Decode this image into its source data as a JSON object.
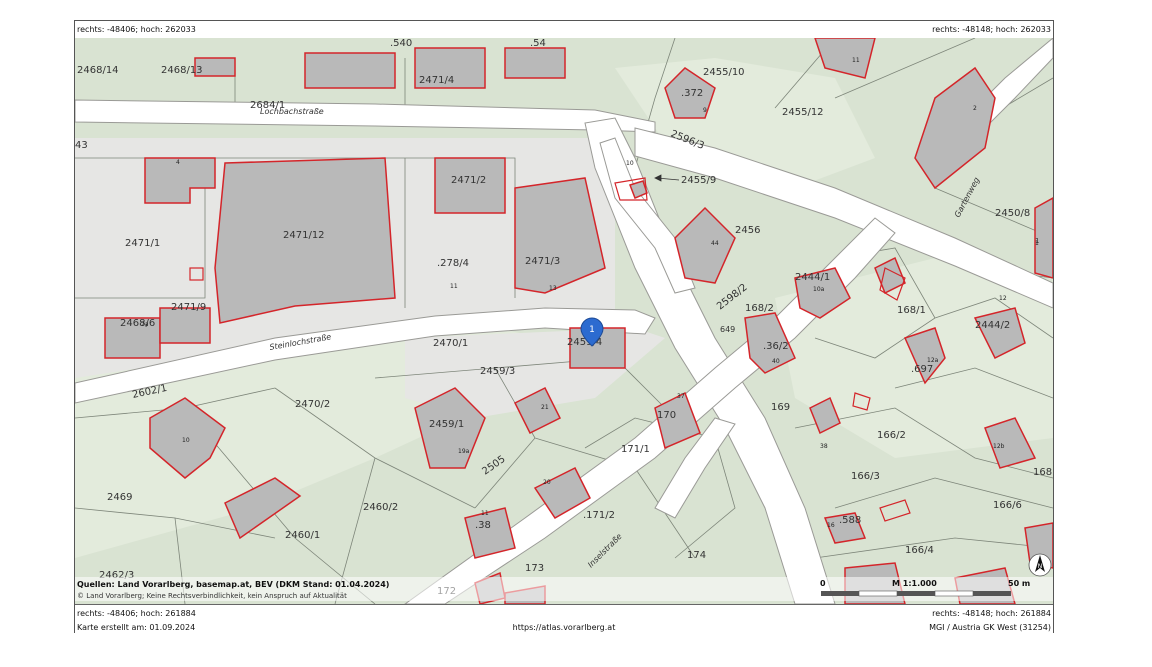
{
  "coords": {
    "top_left": "rechts: -48406; hoch: 262033",
    "top_right": "rechts: -48148; hoch: 262033",
    "bottom_left": "rechts: -48406; hoch: 261884",
    "bottom_right": "rechts: -48148; hoch: 261884"
  },
  "footer": {
    "created": "Karte erstellt am: 01.09.2024",
    "url": "https://atlas.vorarlberg.at",
    "projection": "MGI / Austria GK West (31254)"
  },
  "attribution": {
    "line1": "Quellen: Land Vorarlberg, basemap.at, BEV (DKM Stand: 01.04.2024)",
    "line2": "© Land Vorarlberg; Keine Rechtsverbindlichkeit, kein Anspruch auf Aktualität"
  },
  "scale": {
    "zero": "0",
    "ratio": "M 1:1.000",
    "distance": "50 m"
  },
  "north_arrow": {
    "letter": "N",
    "icon": "north-arrow-icon"
  },
  "marker": {
    "number": "1",
    "icon": "map-pin-icon"
  },
  "streets": {
    "lochbach": "Lochbachstraße",
    "steinloch": "Steinlochstraße",
    "garten": "Gartenweg",
    "insel": "Inselstraße"
  },
  "parcels": {
    "p2468_14": "2468/14",
    "p2468_13": "2468/13",
    "p2471_4": "2471/4",
    "p540": ".540",
    "p54": ".54",
    "p2455_10": "2455/10",
    "p372": ".372",
    "p2455_12": "2455/12",
    "p2684_1": "2684/1",
    "p43": "43",
    "p2596_3": "2596/3",
    "p2471_2": "2471/2",
    "p2455_9": "2455/9",
    "p2471_12": "2471/12",
    "p2471_1": "2471/1",
    "p278_4": ".278/4",
    "p2471_3": "2471/3",
    "p2456": "2456",
    "p2450_8": "2450/8",
    "p2444_1": "2444/1",
    "p2598_2": "2598/2",
    "p168_2": "168/2",
    "p168_1": "168/1",
    "p2444_2": "2444/2",
    "p2468_6": "2468/6",
    "p2471_9": "2471/9",
    "p2470_1": "2470/1",
    "p2459_4": "2459/4",
    "p649": "649",
    "p36_2": ".36/2",
    "p697": ".697",
    "p2602_1": "2602/1",
    "p2459_3": "2459/3",
    "p2470_2": "2470/2",
    "p170": "170",
    "p169": "169",
    "p2459_1": "2459/1",
    "p171_1": "171/1",
    "p166_2": "166/2",
    "p168": "168",
    "p2505": "2505",
    "p166_3": "166/3",
    "p2469": "2469",
    "p2460_2": "2460/2",
    "p38": ".38",
    "p171_2": ".171/2",
    "p588": ".588",
    "p166_6": "166/6",
    "p2460_1": "2460/1",
    "p174": "174",
    "p166_4": "166/4",
    "p2462_3": "2462/3",
    "p173": "173",
    "p172": "172",
    "p1": "1"
  },
  "house_numbers": {
    "h4": "4",
    "h11a": "11",
    "h9": "9",
    "h2": "2",
    "h10a": "10",
    "h1": "1",
    "h44": "44",
    "h11b": "11",
    "h13": "13",
    "h10b": "10a",
    "h12": "12",
    "h7a": "7a",
    "h18": "18",
    "h40": "40",
    "h12a": "12a",
    "h10c": "10",
    "h21": "21",
    "h37": "37",
    "h38": "38",
    "h19a": "19a",
    "h12b": "12b",
    "h11c": "11",
    "h20": "20",
    "h16": "16"
  }
}
